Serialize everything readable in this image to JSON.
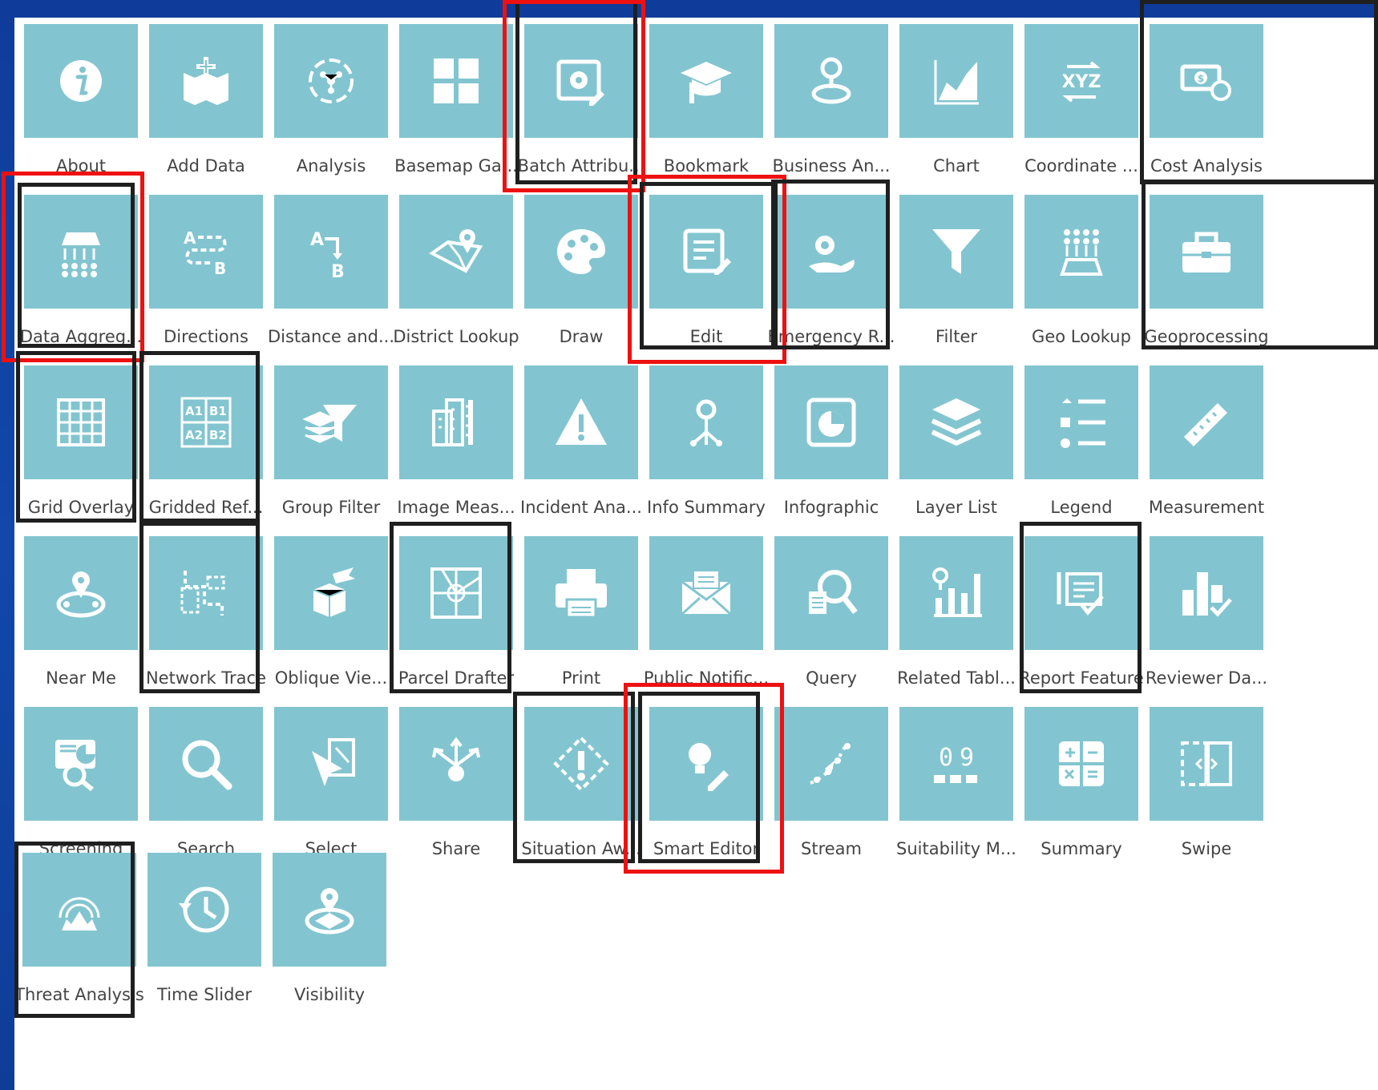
{
  "widgets": [
    {
      "label": "About",
      "icon": "info-icon"
    },
    {
      "label": "Add Data",
      "icon": "add-data-icon"
    },
    {
      "label": "Analysis",
      "icon": "analysis-icon"
    },
    {
      "label": "Basemap Ga...",
      "icon": "basemap-gallery-icon"
    },
    {
      "label": "Batch Attribu...",
      "icon": "batch-attribute-icon"
    },
    {
      "label": "Bookmark",
      "icon": "bookmark-icon"
    },
    {
      "label": "Business An...",
      "icon": "business-analyst-icon"
    },
    {
      "label": "Chart",
      "icon": "chart-icon"
    },
    {
      "label": "Coordinate ...",
      "icon": "coordinate-icon"
    },
    {
      "label": "Cost Analysis",
      "icon": "cost-analysis-icon"
    },
    {
      "label": "Data Aggreg...",
      "icon": "data-aggregation-icon"
    },
    {
      "label": "Directions",
      "icon": "directions-icon"
    },
    {
      "label": "Distance and...",
      "icon": "distance-direction-icon"
    },
    {
      "label": "District Lookup",
      "icon": "district-lookup-icon"
    },
    {
      "label": "Draw",
      "icon": "draw-palette-icon"
    },
    {
      "label": "Edit",
      "icon": "edit-icon"
    },
    {
      "label": "Emergency R...",
      "icon": "emergency-response-icon"
    },
    {
      "label": "Filter",
      "icon": "filter-icon"
    },
    {
      "label": "Geo Lookup",
      "icon": "geo-lookup-icon"
    },
    {
      "label": "Geoprocessing",
      "icon": "toolbox-icon"
    },
    {
      "label": "Grid Overlay",
      "icon": "grid-overlay-icon"
    },
    {
      "label": "Gridded Ref...",
      "icon": "gridded-reference-icon"
    },
    {
      "label": "Group Filter",
      "icon": "group-filter-icon"
    },
    {
      "label": "Image Meas...",
      "icon": "image-measurement-icon"
    },
    {
      "label": "Incident Ana...",
      "icon": "incident-warning-icon"
    },
    {
      "label": "Info Summary",
      "icon": "info-summary-icon"
    },
    {
      "label": "Infographic",
      "icon": "infographic-icon"
    },
    {
      "label": "Layer List",
      "icon": "layer-list-icon"
    },
    {
      "label": "Legend",
      "icon": "legend-icon"
    },
    {
      "label": "Measurement",
      "icon": "ruler-icon"
    },
    {
      "label": "Near Me",
      "icon": "near-me-icon"
    },
    {
      "label": "Network Trace",
      "icon": "network-trace-icon"
    },
    {
      "label": "Oblique Vie...",
      "icon": "oblique-viewer-icon"
    },
    {
      "label": "Parcel Drafter",
      "icon": "parcel-drafter-icon"
    },
    {
      "label": "Print",
      "icon": "printer-icon"
    },
    {
      "label": "Public Notific...",
      "icon": "envelope-icon"
    },
    {
      "label": "Query",
      "icon": "query-icon"
    },
    {
      "label": "Related Tabl...",
      "icon": "related-table-icon"
    },
    {
      "label": "Report Feature",
      "icon": "report-feature-icon"
    },
    {
      "label": "Reviewer Da...",
      "icon": "reviewer-dashboard-icon"
    },
    {
      "label": "Screening",
      "icon": "screening-icon"
    },
    {
      "label": "Search",
      "icon": "search-icon"
    },
    {
      "label": "Select",
      "icon": "select-cursor-icon"
    },
    {
      "label": "Share",
      "icon": "share-icon"
    },
    {
      "label": "Situation Aw...",
      "icon": "situation-awareness-icon"
    },
    {
      "label": "Smart Editor",
      "icon": "smart-editor-icon"
    },
    {
      "label": "Stream",
      "icon": "stream-icon"
    },
    {
      "label": "Suitability M...",
      "icon": "suitability-modeler-icon"
    },
    {
      "label": "Summary",
      "icon": "calculator-icon"
    },
    {
      "label": "Swipe",
      "icon": "swipe-icon"
    },
    {
      "label": "Threat Analysis",
      "icon": "threat-analysis-icon"
    },
    {
      "label": "Time Slider",
      "icon": "clock-history-icon"
    },
    {
      "label": "Visibility",
      "icon": "visibility-icon"
    }
  ],
  "highlight_colors": {
    "black": "#1f1f1f",
    "red": "#ee1111"
  },
  "tile_color": "#82c5d0"
}
